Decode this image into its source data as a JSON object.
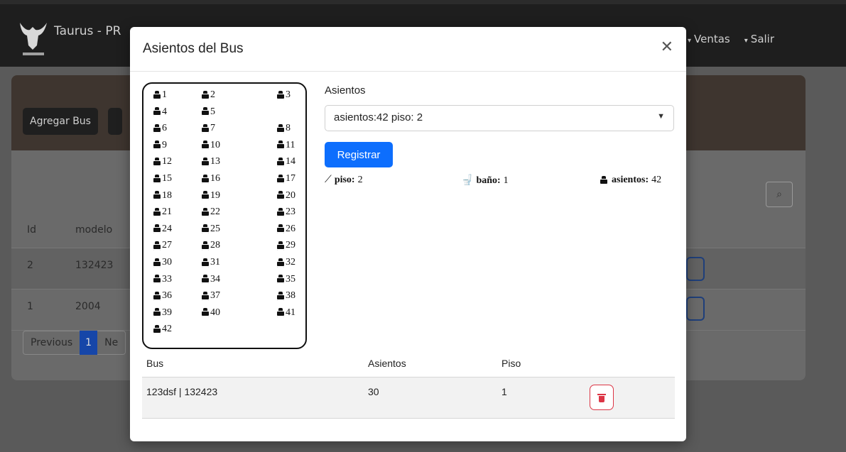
{
  "background": {
    "brand": "Taurus - PR",
    "nav": {
      "ventas": "Ventas",
      "salir": "Salir"
    },
    "add_bus_label": "Agregar Bus",
    "table_headers": {
      "id": "Id",
      "modelo": "modelo"
    },
    "rows": [
      {
        "id": "2",
        "modelo": "132423"
      },
      {
        "id": "1",
        "modelo": "2004"
      }
    ],
    "pager": {
      "previous": "Previous",
      "page": "1",
      "next": "Ne"
    }
  },
  "modal": {
    "title": "Asientos del Bus",
    "close_icon": "close-icon",
    "seats_label": "Asientos",
    "select_value": "asientos:42 piso: 2",
    "register_label": "Registrar",
    "stats": {
      "piso_label": "piso:",
      "piso_value": "2",
      "bano_label": "baño:",
      "bano_value": "1",
      "asientos_label": "asientos:",
      "asientos_value": "42"
    },
    "seats": [
      "1",
      "2",
      "3",
      "4",
      "5",
      "6",
      "7",
      "8",
      "9",
      "10",
      "11",
      "12",
      "13",
      "14",
      "15",
      "16",
      "17",
      "18",
      "19",
      "20",
      "21",
      "22",
      "23",
      "24",
      "25",
      "26",
      "27",
      "28",
      "29",
      "30",
      "31",
      "32",
      "33",
      "34",
      "35",
      "36",
      "37",
      "38",
      "39",
      "40",
      "41",
      "42"
    ],
    "table": {
      "headers": {
        "bus": "Bus",
        "asientos": "Asientos",
        "piso": "Piso"
      },
      "rows": [
        {
          "bus": "123dsf | 132423",
          "asientos": "30",
          "piso": "1"
        }
      ]
    }
  },
  "colors": {
    "primary": "#0d6efd",
    "danger": "#dc3545",
    "navbar": "#1e1e1e"
  }
}
